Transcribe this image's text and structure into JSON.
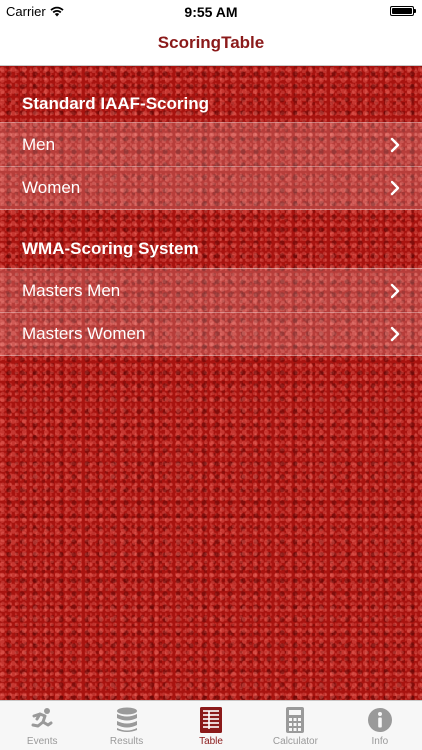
{
  "status_bar": {
    "carrier": "Carrier",
    "time": "9:55 AM"
  },
  "nav": {
    "title": "ScoringTable"
  },
  "sections": [
    {
      "header": "Standard IAAF-Scoring",
      "rows": [
        {
          "label": "Men"
        },
        {
          "label": "Women"
        }
      ]
    },
    {
      "header": "WMA-Scoring System",
      "rows": [
        {
          "label": "Masters Men"
        },
        {
          "label": "Masters Women"
        }
      ]
    }
  ],
  "tabs": [
    {
      "label": "Events",
      "icon": "runner-icon",
      "active": false
    },
    {
      "label": "Results",
      "icon": "database-icon",
      "active": false
    },
    {
      "label": "Table",
      "icon": "table-icon",
      "active": true
    },
    {
      "label": "Calculator",
      "icon": "calculator-icon",
      "active": false
    },
    {
      "label": "Info",
      "icon": "info-icon",
      "active": false
    }
  ],
  "colors": {
    "accent": "#8b1a1a",
    "background": "#a8130f",
    "tab_inactive": "#9a9a9a"
  }
}
